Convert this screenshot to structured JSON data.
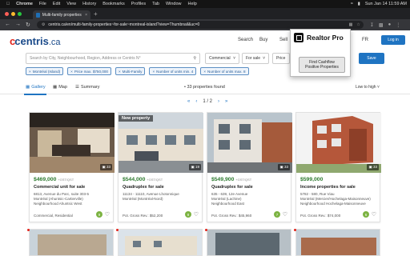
{
  "macos_menu": {
    "app": "Chrome",
    "items": [
      "File",
      "Edit",
      "View",
      "History",
      "Bookmarks",
      "Profiles",
      "Tab",
      "Window",
      "Help"
    ],
    "datetime": "Sun Jan 14  11:59 AM"
  },
  "browser": {
    "tab_title": "Multi-family properties for sa",
    "url": "centris.ca/en/multi-family-properties~for-sale~montreal-island?view=Thumbnail&uc=0"
  },
  "site": {
    "logo_main": "centris",
    "logo_tld": ".ca",
    "nav": [
      "Search",
      "Buy",
      "Sell"
    ],
    "lang": "FR",
    "login": "Log in"
  },
  "search": {
    "placeholder": "Search by City, Neighbourhood, Region, Address or Centris N°",
    "category": "Commercial",
    "listing_type": "For sale",
    "price_label": "Price",
    "save": "Save"
  },
  "filters": [
    "Montréal (Island)",
    "Price max. $750,000",
    "Multi-Family",
    "Number of units min. 4",
    "Number of units max. 8"
  ],
  "views": {
    "gallery": "Gallery",
    "map": "Map",
    "summary": "Summary"
  },
  "results": {
    "count_text": "• 33 properties found",
    "sort": "Low to high",
    "page": "1 / 2"
  },
  "listings": [
    {
      "badge": "",
      "photos": "33",
      "price": "$469,000",
      "plus": "+GST/QST",
      "title": "Commercial unit for sale",
      "lines": [
        "6813, Avenue du Parc, suite 303-5",
        "Montréal (Ahuntsic-Cartierville)",
        "Neighbourhood Ahuntsic West"
      ],
      "footer": "Commercial, Residential",
      "score": "9"
    },
    {
      "badge": "New property",
      "photos": "19",
      "price": "$544,000",
      "plus": "+GST/QST",
      "title": "Quadruplex for sale",
      "lines": [
        "11134 - 11110, Avenue Lhotonnique",
        "Montréal (Montréal-Nord)",
        ""
      ],
      "footer": "Pot. Gross Rev.: $52,200",
      "score": "8"
    },
    {
      "badge": "",
      "photos": "33",
      "price": "$549,900",
      "plus": "+GST/QST",
      "title": "Quadruplex for sale",
      "lines": [
        "635 - 639, 12e Avenue",
        "Montréal (Lachine)",
        "Neighbourhood East"
      ],
      "footer": "Pot. Gross Rev.: $45,960",
      "score": "7"
    },
    {
      "badge": "",
      "photos": "33",
      "price": "$599,000",
      "plus": "",
      "title": "Income properties for sale",
      "lines": [
        "5782 - 580, Rue Viau",
        "Montréal (Mercier/Hochelaga-Maisonneuve)",
        "Neighbourhood Hochelaga-Maisonneuve"
      ],
      "footer": "Pot. Gross Rev.: $74,000",
      "score": "6"
    }
  ],
  "extension_popup": {
    "name": "Realtor Pro",
    "button": "Find Cashflow Positive Properties"
  }
}
